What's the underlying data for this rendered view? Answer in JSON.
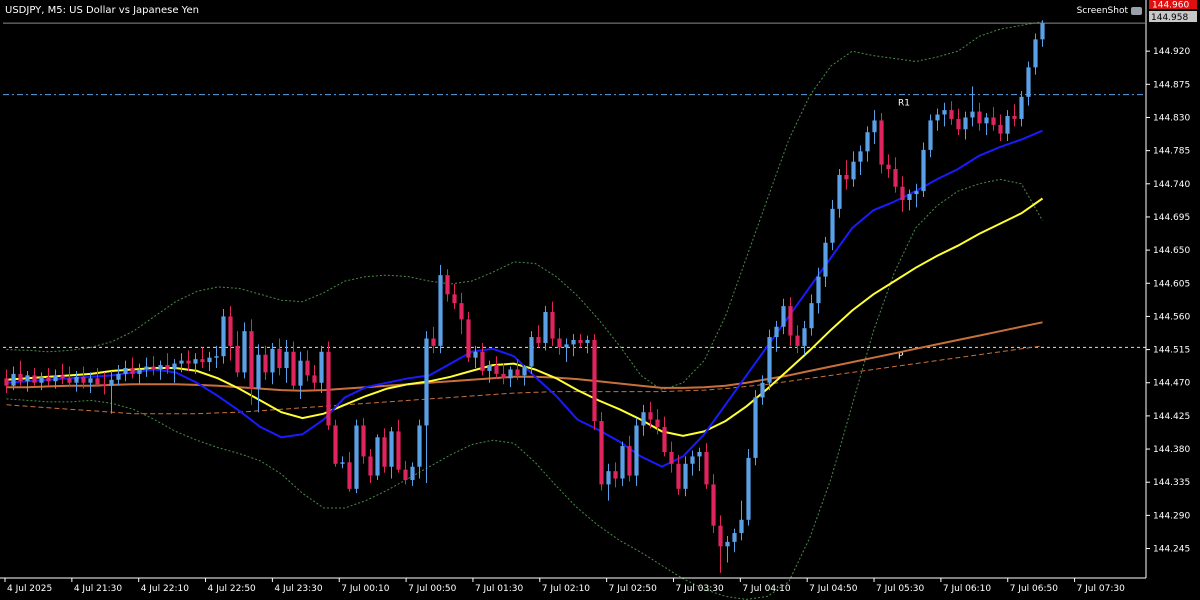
{
  "chart_data": {
    "type": "candlestick",
    "title": "USDJPY, M5:  US Dollar vs Japanese Yen",
    "symbol": "USDJPY",
    "timeframe": "M5",
    "screenshot_label": "ScreenShot",
    "price_labels": {
      "ask": "144.960",
      "bid": "144.958"
    },
    "y_ticks": [
      "144.920",
      "144.875",
      "144.830",
      "144.785",
      "144.740",
      "144.695",
      "144.650",
      "144.605",
      "144.560",
      "144.515",
      "144.470",
      "144.425",
      "144.380",
      "144.335",
      "144.290",
      "144.245"
    ],
    "x_ticks": [
      "4 Jul 2025",
      "4 Jul 21:30",
      "4 Jul 22:10",
      "4 Jul 22:50",
      "4 Jul 23:30",
      "7 Jul 00:10",
      "7 Jul 00:50",
      "7 Jul 01:30",
      "7 Jul 02:10",
      "7 Jul 02:50",
      "7 Jul 03:30",
      "7 Jul 04:10",
      "7 Jul 04:50",
      "7 Jul 05:30",
      "7 Jul 06:10",
      "7 Jul 06:50",
      "7 Jul 07:30"
    ],
    "ylim": [
      144.205,
      144.965
    ],
    "pivot_levels": [
      {
        "label": "R1",
        "value": 144.861
      },
      {
        "label": "P",
        "value": 144.518
      }
    ],
    "colors": {
      "bull": "#5aa0e6",
      "bear": "#e0245e",
      "doji": "#2ea02e",
      "ma_fast": "#1a1aff",
      "ma_mid": "#ffff33",
      "ma_slow": "#c8703c",
      "bands": "#4a8a4a",
      "pivot": "#e0e0e0",
      "r1": "#5aa0e6"
    },
    "candles": [
      [
        144.476,
        144.488,
        144.456,
        144.466
      ],
      [
        144.466,
        144.492,
        144.46,
        144.482
      ],
      [
        144.482,
        144.5,
        144.466,
        144.472
      ],
      [
        144.472,
        144.486,
        144.458,
        144.48
      ],
      [
        144.48,
        144.49,
        144.466,
        144.47
      ],
      [
        144.47,
        144.484,
        144.46,
        144.478
      ],
      [
        144.478,
        144.49,
        144.466,
        144.472
      ],
      [
        144.472,
        144.488,
        144.462,
        144.48
      ],
      [
        144.48,
        144.496,
        144.468,
        144.476
      ],
      [
        144.476,
        144.492,
        144.464,
        144.47
      ],
      [
        144.47,
        144.486,
        144.458,
        144.478
      ],
      [
        144.478,
        144.492,
        144.462,
        144.47
      ],
      [
        144.47,
        144.484,
        144.456,
        144.476
      ],
      [
        144.476,
        144.49,
        144.464,
        144.468
      ],
      [
        144.468,
        144.484,
        144.454,
        144.466
      ],
      [
        144.466,
        144.486,
        144.428,
        144.474
      ],
      [
        144.474,
        144.494,
        144.466,
        144.482
      ],
      [
        144.482,
        144.5,
        144.472,
        144.49
      ],
      [
        144.49,
        144.504,
        144.476,
        144.482
      ],
      [
        144.482,
        144.496,
        144.468,
        144.488
      ],
      [
        144.488,
        144.504,
        144.478,
        144.492
      ],
      [
        144.492,
        144.506,
        144.48,
        144.488
      ],
      [
        144.488,
        144.5,
        144.474,
        144.494
      ],
      [
        144.494,
        144.51,
        144.482,
        144.488
      ],
      [
        144.488,
        144.502,
        144.47,
        144.496
      ],
      [
        144.496,
        144.51,
        144.484,
        144.5
      ],
      [
        144.5,
        144.514,
        144.486,
        144.496
      ],
      [
        144.496,
        144.51,
        144.482,
        144.502
      ],
      [
        144.502,
        144.518,
        144.49,
        144.498
      ],
      [
        144.498,
        144.512,
        144.486,
        144.504
      ],
      [
        144.504,
        144.52,
        144.49,
        144.506
      ],
      [
        144.506,
        144.57,
        144.496,
        144.56
      ],
      [
        144.56,
        144.574,
        144.5,
        144.52
      ],
      [
        144.52,
        144.54,
        144.478,
        144.484
      ],
      [
        144.484,
        144.552,
        144.476,
        144.54
      ],
      [
        144.54,
        144.556,
        144.44,
        144.462
      ],
      [
        144.462,
        144.522,
        144.43,
        144.508
      ],
      [
        144.508,
        144.52,
        144.474,
        144.484
      ],
      [
        144.484,
        144.524,
        144.468,
        144.516
      ],
      [
        144.516,
        144.53,
        144.48,
        144.49
      ],
      [
        144.49,
        144.528,
        144.47,
        144.512
      ],
      [
        144.512,
        144.526,
        144.46,
        144.466
      ],
      [
        144.466,
        144.512,
        144.448,
        144.5
      ],
      [
        144.5,
        144.514,
        144.472,
        144.48
      ],
      [
        144.48,
        144.494,
        144.46,
        144.47
      ],
      [
        144.47,
        144.52,
        144.456,
        144.512
      ],
      [
        144.512,
        144.526,
        144.406,
        144.412
      ],
      [
        144.412,
        144.42,
        144.356,
        144.36
      ],
      [
        144.36,
        144.37,
        144.354,
        144.362
      ],
      [
        144.362,
        144.376,
        144.322,
        144.326
      ],
      [
        144.326,
        144.42,
        144.32,
        144.412
      ],
      [
        144.412,
        144.422,
        144.36,
        144.37
      ],
      [
        144.37,
        144.38,
        144.334,
        144.344
      ],
      [
        144.344,
        144.4,
        144.338,
        144.396
      ],
      [
        144.396,
        144.408,
        144.348,
        144.356
      ],
      [
        144.356,
        144.41,
        144.34,
        144.404
      ],
      [
        144.404,
        144.42,
        144.348,
        144.352
      ],
      [
        144.352,
        144.364,
        144.332,
        144.338
      ],
      [
        144.338,
        144.362,
        144.33,
        144.356
      ],
      [
        144.356,
        144.42,
        144.34,
        144.412
      ],
      [
        144.412,
        144.54,
        144.334,
        144.53
      ],
      [
        144.53,
        144.546,
        144.51,
        144.52
      ],
      [
        144.52,
        144.63,
        144.51,
        144.616
      ],
      [
        144.616,
        144.624,
        144.58,
        144.59
      ],
      [
        144.59,
        144.604,
        144.57,
        144.578
      ],
      [
        144.578,
        144.592,
        144.536,
        144.556
      ],
      [
        144.556,
        144.566,
        144.498,
        144.504
      ],
      [
        144.504,
        144.52,
        144.49,
        144.512
      ],
      [
        144.512,
        144.524,
        144.48,
        144.486
      ],
      [
        144.486,
        144.5,
        144.47,
        144.494
      ],
      [
        144.494,
        144.506,
        144.476,
        144.482
      ],
      [
        144.482,
        144.496,
        144.468,
        144.476
      ],
      [
        144.476,
        144.492,
        144.464,
        144.488
      ],
      [
        144.488,
        144.502,
        144.474,
        144.48
      ],
      [
        144.48,
        144.494,
        144.466,
        144.492
      ],
      [
        144.492,
        144.54,
        144.482,
        144.532
      ],
      [
        144.532,
        144.548,
        144.518,
        144.524
      ],
      [
        144.524,
        144.574,
        144.514,
        144.566
      ],
      [
        144.566,
        144.58,
        144.52,
        144.53
      ],
      [
        144.53,
        144.544,
        144.508,
        144.518
      ],
      [
        144.518,
        144.53,
        144.498,
        144.522
      ],
      [
        144.522,
        144.536,
        144.506,
        144.528
      ],
      [
        144.528,
        144.536,
        144.518,
        144.524
      ],
      [
        144.524,
        144.534,
        144.51,
        144.528
      ],
      [
        144.528,
        144.536,
        144.406,
        144.418
      ],
      [
        144.418,
        144.43,
        144.324,
        144.332
      ],
      [
        144.332,
        144.36,
        144.31,
        144.35
      ],
      [
        144.35,
        144.362,
        144.328,
        144.34
      ],
      [
        144.34,
        144.39,
        144.33,
        144.384
      ],
      [
        144.384,
        144.398,
        144.336,
        144.344
      ],
      [
        144.344,
        144.422,
        144.33,
        144.412
      ],
      [
        144.412,
        144.44,
        144.398,
        144.43
      ],
      [
        144.43,
        144.444,
        144.408,
        144.42
      ],
      [
        144.42,
        144.434,
        144.4,
        144.41
      ],
      [
        144.41,
        144.424,
        144.37,
        144.376
      ],
      [
        144.376,
        144.39,
        144.348,
        144.36
      ],
      [
        144.36,
        144.372,
        144.318,
        144.326
      ],
      [
        144.326,
        144.37,
        144.316,
        144.36
      ],
      [
        144.36,
        144.378,
        144.344,
        144.37
      ],
      [
        144.37,
        144.382,
        144.35,
        144.376
      ],
      [
        144.376,
        144.388,
        144.326,
        144.332
      ],
      [
        144.332,
        144.346,
        144.266,
        144.276
      ],
      [
        144.276,
        144.29,
        144.212,
        144.248
      ],
      [
        144.248,
        144.262,
        144.226,
        144.254
      ],
      [
        144.254,
        144.272,
        144.24,
        144.266
      ],
      [
        144.266,
        144.31,
        144.256,
        144.284
      ],
      [
        144.284,
        144.38,
        144.276,
        144.368
      ],
      [
        144.368,
        144.46,
        144.358,
        144.45
      ],
      [
        144.45,
        144.48,
        144.44,
        144.47
      ],
      [
        144.47,
        144.542,
        144.46,
        144.532
      ],
      [
        144.532,
        144.554,
        144.512,
        144.546
      ],
      [
        144.546,
        144.584,
        144.536,
        144.574
      ],
      [
        144.574,
        144.586,
        144.52,
        144.534
      ],
      [
        144.534,
        144.548,
        144.51,
        144.52
      ],
      [
        144.52,
        144.554,
        144.508,
        144.544
      ],
      [
        144.544,
        144.59,
        144.534,
        144.578
      ],
      [
        144.578,
        144.626,
        144.564,
        144.614
      ],
      [
        144.614,
        144.668,
        144.6,
        144.66
      ],
      [
        144.66,
        144.718,
        144.65,
        144.706
      ],
      [
        144.706,
        144.76,
        144.694,
        144.752
      ],
      [
        144.752,
        144.772,
        144.732,
        144.746
      ],
      [
        144.746,
        144.784,
        144.736,
        144.77
      ],
      [
        144.77,
        144.792,
        144.752,
        144.784
      ],
      [
        144.784,
        144.818,
        144.77,
        144.81
      ],
      [
        144.81,
        144.84,
        144.794,
        144.826
      ],
      [
        144.826,
        144.836,
        144.754,
        144.766
      ],
      [
        144.766,
        144.78,
        144.748,
        144.76
      ],
      [
        144.76,
        144.776,
        144.728,
        144.736
      ],
      [
        144.736,
        144.75,
        144.702,
        144.718
      ],
      [
        144.718,
        144.732,
        144.704,
        144.726
      ],
      [
        144.726,
        144.74,
        144.708,
        144.73
      ],
      [
        144.73,
        144.796,
        144.722,
        144.786
      ],
      [
        144.786,
        144.834,
        144.776,
        144.826
      ],
      [
        144.826,
        144.842,
        144.812,
        144.834
      ],
      [
        144.834,
        144.85,
        144.818,
        144.84
      ],
      [
        144.84,
        144.852,
        144.82,
        144.828
      ],
      [
        144.828,
        144.842,
        144.806,
        144.814
      ],
      [
        144.814,
        144.838,
        144.8,
        144.83
      ],
      [
        144.83,
        144.872,
        144.818,
        144.838
      ],
      [
        144.838,
        144.85,
        144.812,
        144.822
      ],
      [
        144.822,
        144.836,
        144.806,
        144.83
      ],
      [
        144.83,
        144.844,
        144.812,
        144.82
      ],
      [
        144.82,
        144.834,
        144.798,
        144.808
      ],
      [
        144.808,
        144.84,
        144.798,
        144.832
      ],
      [
        144.832,
        144.848,
        144.818,
        144.828
      ],
      [
        144.828,
        144.866,
        144.818,
        144.858
      ],
      [
        144.858,
        144.906,
        144.846,
        144.898
      ],
      [
        144.898,
        144.944,
        144.888,
        144.936
      ],
      [
        144.936,
        144.962,
        144.926,
        144.958
      ]
    ],
    "ma_fast": [
      144.47,
      144.472,
      144.474,
      144.476,
      144.478,
      144.48,
      144.484,
      144.488,
      144.484,
      144.47,
      144.452,
      144.432,
      144.41,
      144.396,
      144.4,
      144.42,
      144.45,
      144.464,
      144.47,
      144.476,
      144.48,
      144.496,
      144.512,
      144.516,
      144.506,
      144.478,
      144.452,
      144.42,
      144.406,
      144.39,
      144.37,
      144.356,
      144.37,
      144.4,
      144.44,
      144.48,
      144.52,
      144.56,
      144.6,
      144.64,
      144.68,
      144.704,
      144.716,
      144.73,
      144.746,
      144.76,
      144.778,
      144.79,
      144.8,
      144.812
    ],
    "ma_mid": [
      144.474,
      144.476,
      144.478,
      144.48,
      144.482,
      144.486,
      144.488,
      144.49,
      144.49,
      144.486,
      144.476,
      144.462,
      144.446,
      144.43,
      144.422,
      144.428,
      144.44,
      144.452,
      144.462,
      144.468,
      144.472,
      144.478,
      144.486,
      144.494,
      144.496,
      144.488,
      144.476,
      144.46,
      144.446,
      144.434,
      144.42,
      144.404,
      144.398,
      144.404,
      144.418,
      144.438,
      144.462,
      144.488,
      144.514,
      144.542,
      144.568,
      144.59,
      144.608,
      144.626,
      144.642,
      144.656,
      144.672,
      144.686,
      144.7,
      144.72
    ],
    "ma_slow": [
      144.464,
      144.464,
      144.465,
      144.466,
      144.466,
      144.467,
      144.468,
      144.468,
      144.468,
      144.467,
      144.466,
      144.464,
      144.462,
      144.46,
      144.459,
      144.46,
      144.462,
      144.464,
      144.466,
      144.468,
      144.47,
      144.472,
      144.474,
      144.476,
      144.478,
      144.478,
      144.477,
      144.475,
      144.472,
      144.469,
      144.466,
      144.463,
      144.463,
      144.464,
      144.466,
      144.47,
      144.475,
      144.48,
      144.486,
      144.492,
      144.498,
      144.504,
      144.51,
      144.516,
      144.522,
      144.528,
      144.534,
      144.54,
      144.546,
      144.552
    ],
    "ma_slow2": [
      144.44,
      144.438,
      144.436,
      144.434,
      144.432,
      144.43,
      144.428,
      144.428,
      144.428,
      144.428,
      144.429,
      144.43,
      144.432,
      144.434,
      144.436,
      144.438,
      144.44,
      144.442,
      144.444,
      144.446,
      144.448,
      144.45,
      144.452,
      144.454,
      144.456,
      144.457,
      144.458,
      144.458,
      144.458,
      144.458,
      144.458,
      144.458,
      144.459,
      144.46,
      144.462,
      144.465,
      144.468,
      144.472,
      144.476,
      144.48,
      144.484,
      144.488,
      144.492,
      144.496,
      144.5,
      144.504,
      144.508,
      144.512,
      144.516,
      144.52
    ],
    "band_upper": [
      144.515,
      144.514,
      144.512,
      144.514,
      144.518,
      144.526,
      144.54,
      144.56,
      144.58,
      144.594,
      144.6,
      144.598,
      144.59,
      144.582,
      144.58,
      144.592,
      144.608,
      144.614,
      144.616,
      144.614,
      144.608,
      144.604,
      144.608,
      144.62,
      144.634,
      144.632,
      144.614,
      144.588,
      144.556,
      144.52,
      144.48,
      144.46,
      144.47,
      144.5,
      144.56,
      144.64,
      144.72,
      144.8,
      144.86,
      144.9,
      144.92,
      144.914,
      144.91,
      144.906,
      144.912,
      144.92,
      144.94,
      144.95,
      144.955,
      144.96
    ],
    "band_lower": [
      144.448,
      144.446,
      144.444,
      144.444,
      144.446,
      144.442,
      144.434,
      144.42,
      144.404,
      144.392,
      144.382,
      144.374,
      144.364,
      144.346,
      144.32,
      144.3,
      144.3,
      144.31,
      144.324,
      144.34,
      144.356,
      144.372,
      144.386,
      144.392,
      144.388,
      144.362,
      144.33,
      144.3,
      144.276,
      144.256,
      144.24,
      144.222,
      144.204,
      144.19,
      144.18,
      144.176,
      144.18,
      144.2,
      144.26,
      144.34,
      144.44,
      144.54,
      144.62,
      144.68,
      144.71,
      144.73,
      144.74,
      144.746,
      144.74,
      144.69
    ],
    "type_note": ""
  }
}
